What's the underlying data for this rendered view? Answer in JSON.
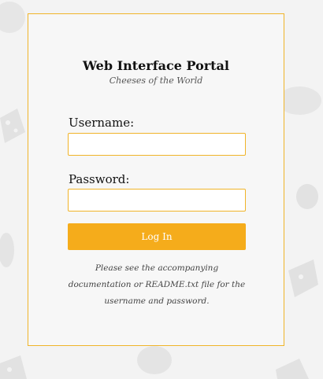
{
  "login": {
    "title": "Web Interface Portal",
    "subtitle": "Cheeses of the World",
    "username_label": "Username:",
    "username_value": "",
    "password_label": "Password:",
    "password_value": "",
    "login_button": "Log In",
    "help_text": "Please see the accompanying documentation or README.txt file for the username and password."
  },
  "colors": {
    "accent": "#f5ac1b",
    "border": "#f0b429",
    "panel_bg": "#f7f7f7",
    "page_bg": "#f3f3f3"
  },
  "background": {
    "pattern_icons": [
      "cheese-wheel-icon",
      "cheese-wedge-icon"
    ]
  }
}
